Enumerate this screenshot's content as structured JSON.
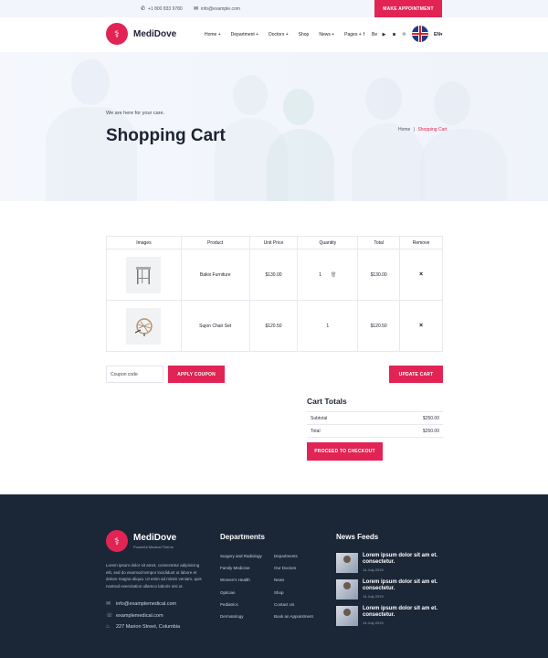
{
  "topbar": {
    "phone": "+1 800 833 9780",
    "email": "info@example.com",
    "appointment_button": "MAKE APPOINTMENT"
  },
  "header": {
    "logo": "MediDove",
    "nav": [
      "Home +",
      "Department +",
      "Doctors +",
      "Shop",
      "News +",
      "Pages +"
    ],
    "social_icons": [
      "facebook-icon",
      "behance-icon",
      "youtube-icon",
      "instagram-icon",
      "pinterest-icon"
    ],
    "social_glyphs": [
      "f",
      "Be",
      "▶",
      "◙",
      "℗"
    ],
    "language": "EN▾"
  },
  "hero": {
    "subtitle": "We are here for your care.",
    "title": "Shopping Cart",
    "breadcrumb_home": "Home",
    "breadcrumb_sep": "|",
    "breadcrumb_current": "Shopping Cart"
  },
  "cart": {
    "headers": [
      "Images",
      "Product",
      "Unit Price",
      "Quantity",
      "Total",
      "Remove"
    ],
    "rows": [
      {
        "product": "Bakix Furniture",
        "unit_price": "$130.00",
        "quantity": "1",
        "total": "$130.00",
        "remove": "×"
      },
      {
        "product": "Sujon Chair Set",
        "unit_price": "$120.50",
        "quantity": "1",
        "total": "$120.50",
        "remove": "×"
      }
    ]
  },
  "coupon": {
    "placeholder": "Coupon code",
    "apply_button": "APPLY COUPON",
    "update_button": "UPDATE CART"
  },
  "totals": {
    "title": "Cart Totals",
    "subtotal_label": "Subtotal",
    "subtotal_value": "$250.00",
    "total_label": "Total",
    "total_value": "$250.00",
    "checkout_button": "PROCEED TO CHECKOUT"
  },
  "footer": {
    "logo": "MediDove",
    "tagline": "Powerful Medical Theme",
    "about": "Lorem ipsum dolor sit amet, consectetur adipisicing elit, sed do eiusmod tempor incididunt ut labore et dolore magna aliqua. Ut enim ad minim veniam, quis nostrud exercitation ullamco laboris nisi ut.",
    "contacts": [
      {
        "icon": "email-icon",
        "glyph": "✉",
        "text": "info@examplemedical.com"
      },
      {
        "icon": "phone-icon",
        "glyph": "☏",
        "text": "examplemedical.com"
      },
      {
        "icon": "location-icon",
        "glyph": "⌂",
        "text": "227 Marion Street, Columbia"
      }
    ],
    "departments_title": "Departments",
    "departments_col1": [
      "Surgery and Radiology",
      "Family Medicine",
      "Women's Health",
      "Optician",
      "Pediatrics",
      "Dermatology"
    ],
    "departments_col2": [
      "Departments",
      "Our Doctors",
      "News",
      "Shop",
      "Contact Us",
      "Book an Appointment"
    ],
    "news_title": "News Feeds",
    "news": [
      {
        "title": "Lorem ipsum dolor sit am et. consectetur.",
        "date": "14 July 2019"
      },
      {
        "title": "Lorem ipsum dolor sit am et. consectetur.",
        "date": "14 July 2019"
      },
      {
        "title": "Lorem ipsum dolor sit am et. consectetur.",
        "date": "14 July 2019"
      }
    ]
  },
  "colors": {
    "accent": "#e12454",
    "footer_bg": "#1b2637",
    "heading": "#1b2333"
  }
}
